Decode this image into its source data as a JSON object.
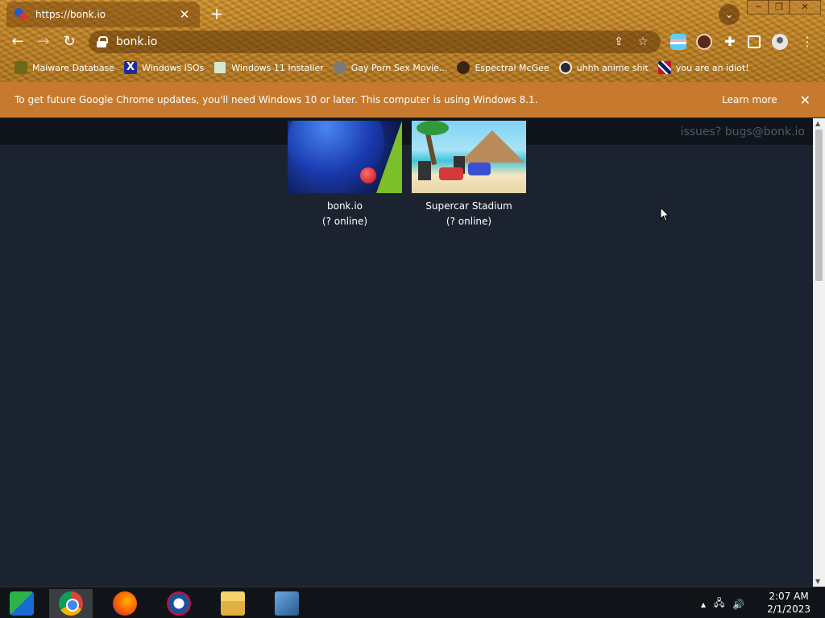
{
  "browser": {
    "tab_title": "https://bonk.io",
    "tab_close": "✕",
    "new_tab": "+",
    "url": "bonk.io",
    "bookmarks": [
      {
        "label": "Malware Database",
        "icon": "malware-icon"
      },
      {
        "label": "Windows ISOs",
        "icon": "x-icon"
      },
      {
        "label": "Windows 11 Installer",
        "icon": "installer-icon"
      },
      {
        "label": "Gay Porn Sex Movie...",
        "icon": "site-icon"
      },
      {
        "label": "Espectral McGee",
        "icon": "avatar-icon"
      },
      {
        "label": "uhhh anime shit",
        "icon": "anime-icon"
      },
      {
        "label": "you are an idiot!",
        "icon": "flag-icon"
      }
    ],
    "infobar": {
      "message": "To get future Google Chrome updates, you'll need Windows 10 or later. This computer is using Windows 8.1.",
      "learn_more": "Learn more",
      "close": "✕"
    }
  },
  "page": {
    "contact": "issues? bugs@bonk.io",
    "games": [
      {
        "name": "bonk.io",
        "online": "(? online)"
      },
      {
        "name": "Supercar Stadium",
        "online": "(? online)"
      }
    ]
  },
  "taskbar": {
    "time": "2:07 AM",
    "date": "2/1/2023"
  },
  "colors": {
    "page_bg": "#1c2330",
    "infobar_bg": "#c77a2d",
    "frame_theme": "#b77b21"
  }
}
